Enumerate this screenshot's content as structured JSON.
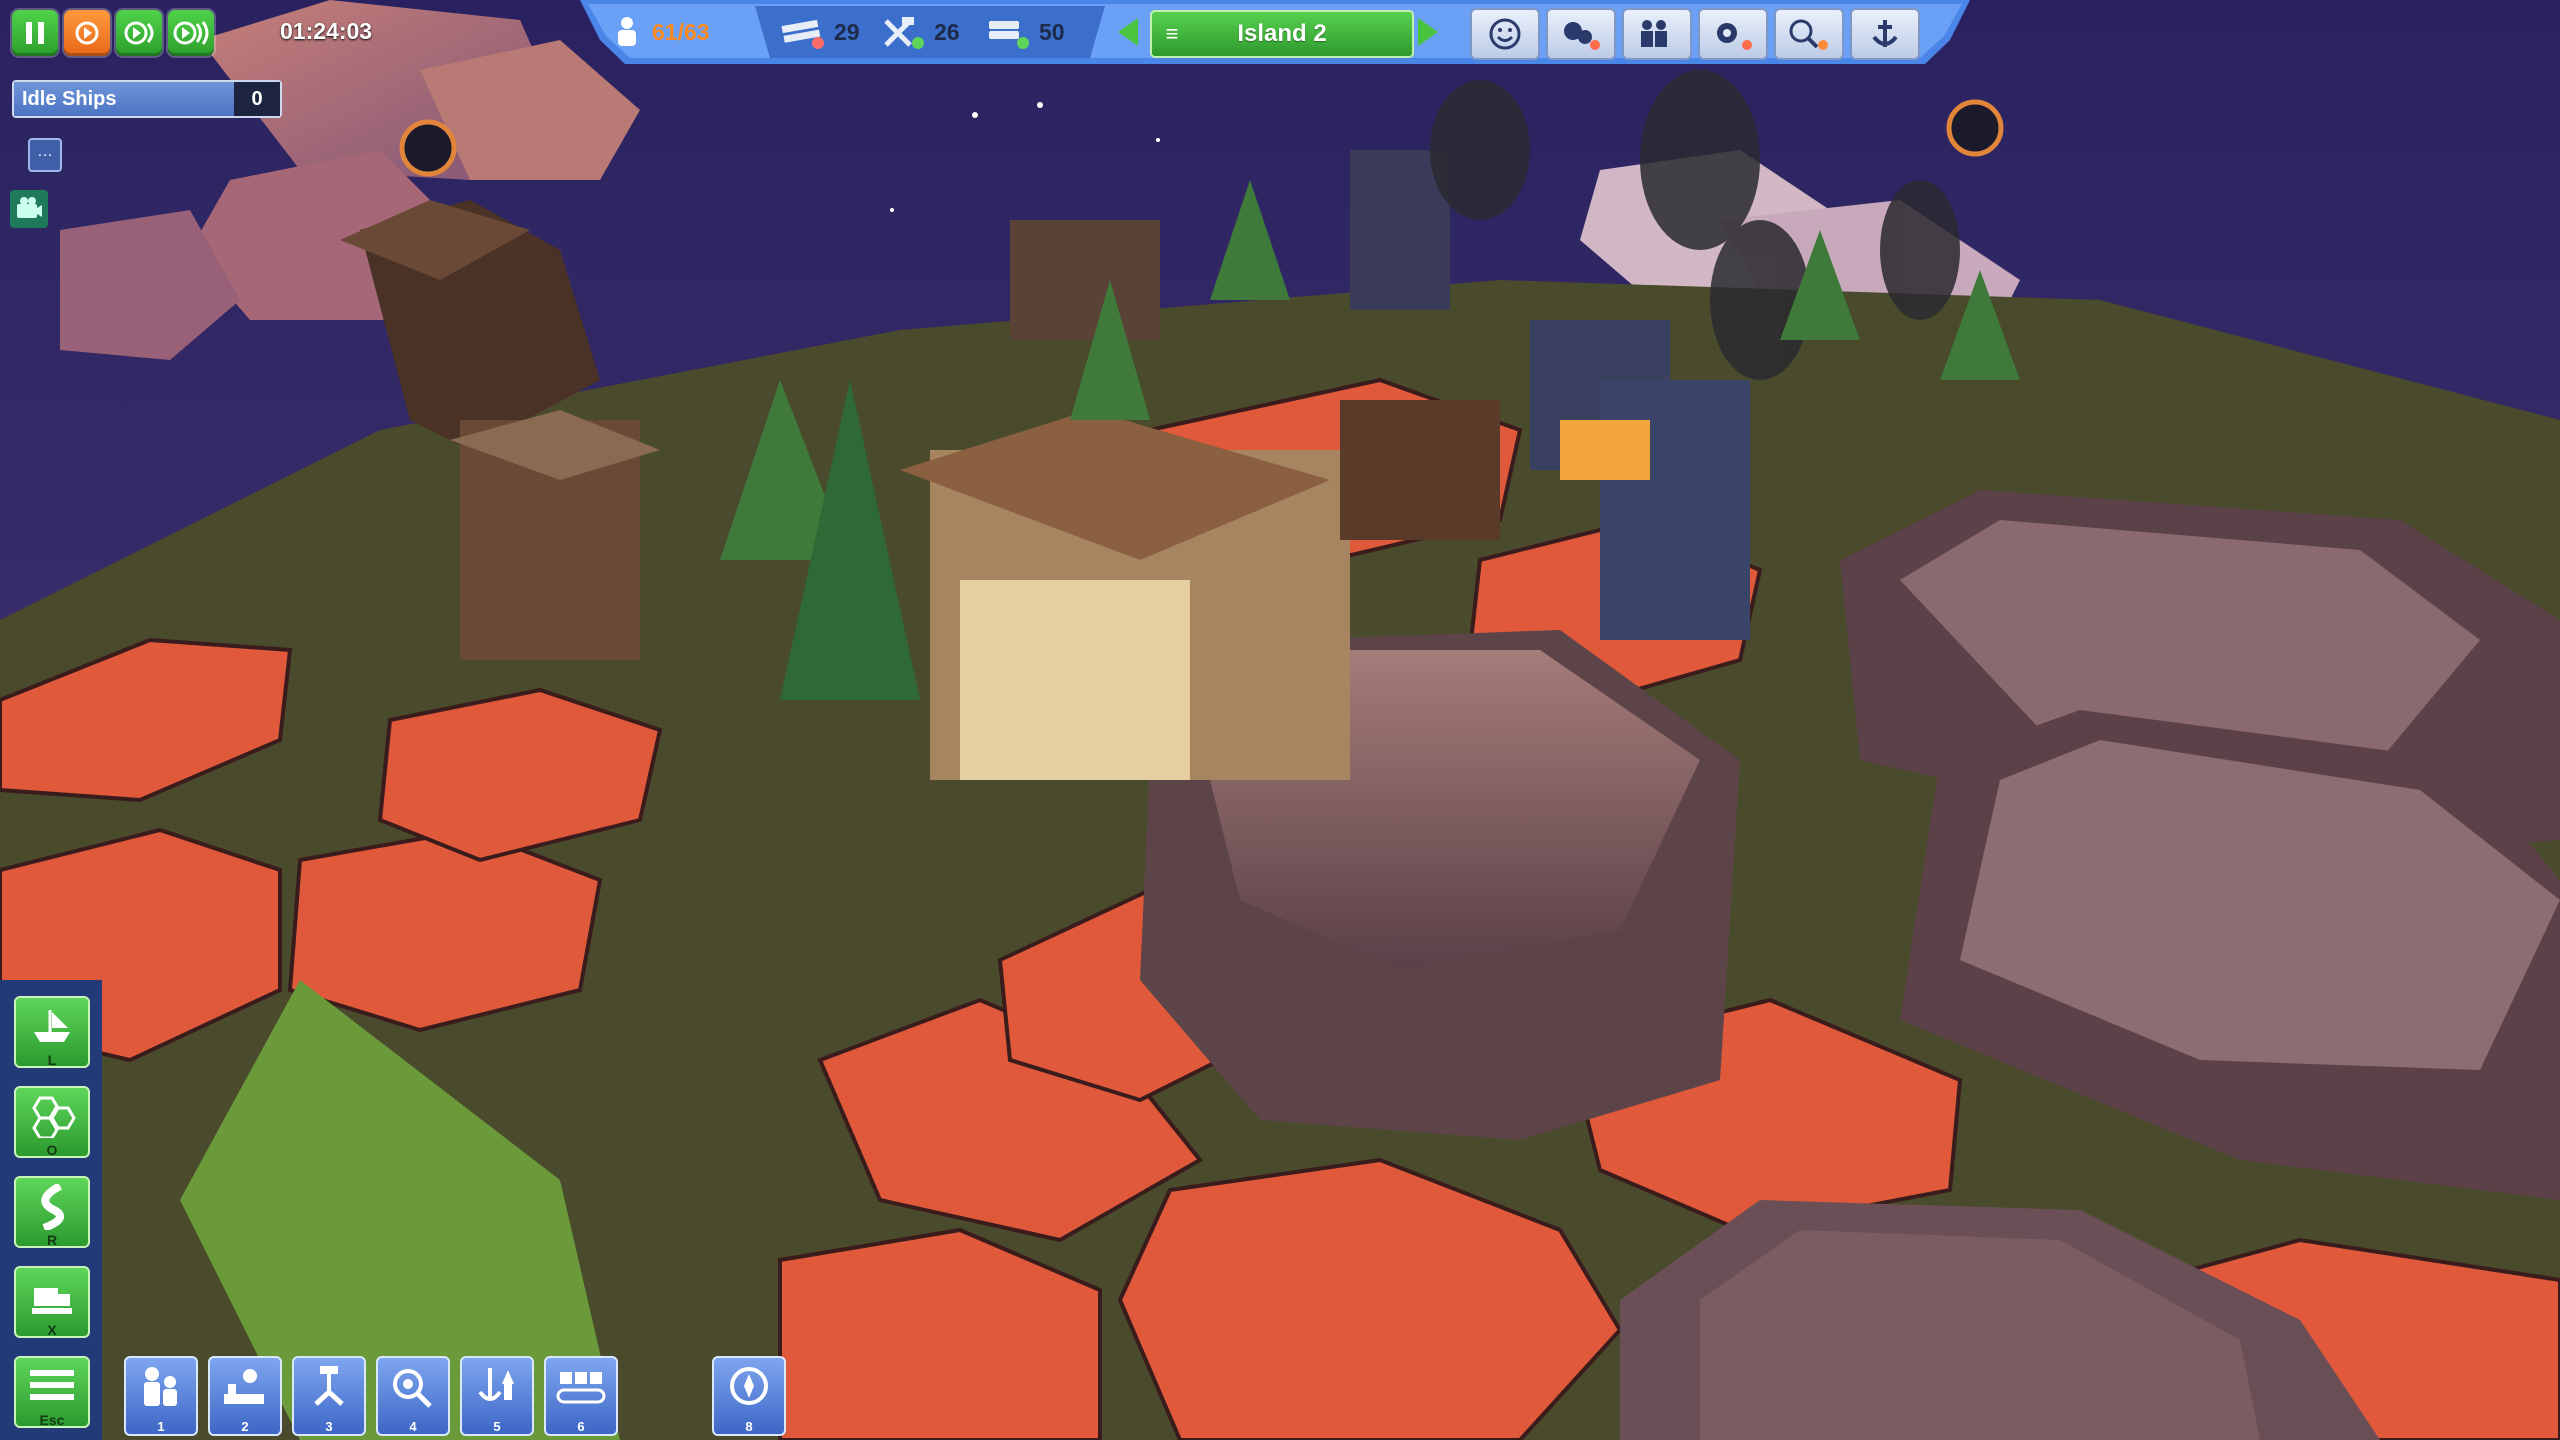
{
  "hud": {
    "clock": "01:24:03",
    "idle_ships_label": "Idle Ships",
    "idle_ships_count": "0",
    "small_button_label": "…"
  },
  "topbar": {
    "population": "61/63",
    "resources": [
      {
        "icon": "planks-icon",
        "value": "29"
      },
      {
        "icon": "tools-icon",
        "value": "26"
      },
      {
        "icon": "stone-icon",
        "value": "50"
      }
    ],
    "island_menu_glyph": "≡",
    "island_name": "Island 2",
    "buttons": [
      "smiley-icon",
      "gears-overlay-icon",
      "workers-overlay-icon",
      "settings-icon",
      "research-icon",
      "anchor-icon"
    ]
  },
  "left_toolbar": [
    {
      "name": "ship-logistics",
      "key": "L"
    },
    {
      "name": "hex-overlay",
      "key": "O"
    },
    {
      "name": "road-tool",
      "key": "R"
    },
    {
      "name": "demolish-tool",
      "key": "X"
    },
    {
      "name": "main-menu",
      "key": "Esc"
    }
  ],
  "bottom_toolbar": [
    {
      "name": "population-buildings",
      "key": "1"
    },
    {
      "name": "food-buildings",
      "key": "2"
    },
    {
      "name": "production-buildings",
      "key": "3"
    },
    {
      "name": "research-buildings",
      "key": "4"
    },
    {
      "name": "harbor-buildings",
      "key": "5"
    },
    {
      "name": "logistics-buildings",
      "key": "6"
    },
    {
      "name": "special-buildings",
      "key": "8"
    }
  ],
  "colors": {
    "sky": "#2b2450",
    "ground_orange": "#e0593a",
    "grass": "#5a5a2e",
    "rock": "#8a6a6a",
    "ui_blue": "#3d66c6",
    "ui_green": "#2f9a2d",
    "accent_orange": "#ff8a1e"
  }
}
